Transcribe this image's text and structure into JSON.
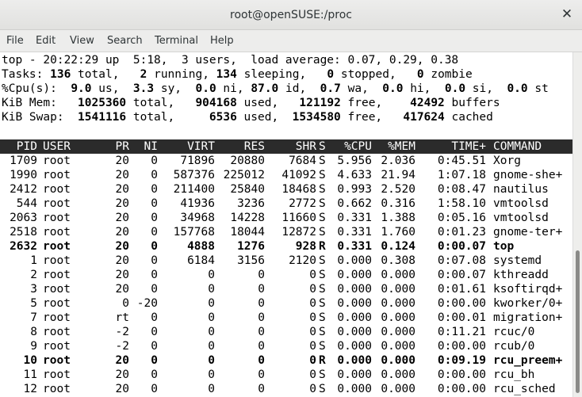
{
  "window": {
    "title": "root@openSUSE:/proc",
    "close_symbol": "✕"
  },
  "menu": [
    "File",
    "Edit",
    "View",
    "Search",
    "Terminal",
    "Help"
  ],
  "summary": [
    [
      {
        "t": "top - 20:22:29 up  5:18,  3 users,  load average: 0.07, 0.29, 0.38"
      }
    ],
    [
      {
        "t": "Tasks: "
      },
      {
        "t": "136",
        "b": true
      },
      {
        "t": " total,   "
      },
      {
        "t": "2",
        "b": true
      },
      {
        "t": " running, "
      },
      {
        "t": "134",
        "b": true
      },
      {
        "t": " sleeping,   "
      },
      {
        "t": "0",
        "b": true
      },
      {
        "t": " stopped,   "
      },
      {
        "t": "0",
        "b": true
      },
      {
        "t": " zombie"
      }
    ],
    [
      {
        "t": "%Cpu(s):  "
      },
      {
        "t": "9.0",
        "b": true
      },
      {
        "t": " us,  "
      },
      {
        "t": "3.3",
        "b": true
      },
      {
        "t": " sy,  "
      },
      {
        "t": "0.0",
        "b": true
      },
      {
        "t": " ni, "
      },
      {
        "t": "87.0",
        "b": true
      },
      {
        "t": " id,  "
      },
      {
        "t": "0.7",
        "b": true
      },
      {
        "t": " wa,  "
      },
      {
        "t": "0.0",
        "b": true
      },
      {
        "t": " hi,  "
      },
      {
        "t": "0.0",
        "b": true
      },
      {
        "t": " si,  "
      },
      {
        "t": "0.0",
        "b": true
      },
      {
        "t": " st"
      }
    ],
    [
      {
        "t": "KiB Mem:   "
      },
      {
        "t": "1025360",
        "b": true
      },
      {
        "t": " total,   "
      },
      {
        "t": "904168",
        "b": true
      },
      {
        "t": " used,   "
      },
      {
        "t": "121192",
        "b": true
      },
      {
        "t": " free,    "
      },
      {
        "t": "42492",
        "b": true
      },
      {
        "t": " buffers"
      }
    ],
    [
      {
        "t": "KiB Swap:  "
      },
      {
        "t": "1541116",
        "b": true
      },
      {
        "t": " total,     "
      },
      {
        "t": "6536",
        "b": true
      },
      {
        "t": " used,  "
      },
      {
        "t": "1534580",
        "b": true
      },
      {
        "t": " free,   "
      },
      {
        "t": "417624",
        "b": true
      },
      {
        "t": " cached"
      }
    ]
  ],
  "table": {
    "columns": [
      "PID",
      "USER",
      "PR",
      "NI",
      "VIRT",
      "RES",
      "SHR",
      "S",
      "%CPU",
      "%MEM",
      "TIME+",
      "COMMAND"
    ],
    "rows": [
      {
        "cells": [
          "1709",
          "root",
          "20",
          "0",
          "71896",
          "20880",
          "7684",
          "S",
          "5.956",
          "2.036",
          "0:45.51",
          "Xorg"
        ]
      },
      {
        "cells": [
          "1990",
          "root",
          "20",
          "0",
          "587376",
          "225012",
          "41092",
          "S",
          "4.633",
          "21.94",
          "1:07.18",
          "gnome-she+"
        ]
      },
      {
        "cells": [
          "2412",
          "root",
          "20",
          "0",
          "211400",
          "25840",
          "18468",
          "S",
          "0.993",
          "2.520",
          "0:08.47",
          "nautilus"
        ]
      },
      {
        "cells": [
          "544",
          "root",
          "20",
          "0",
          "41936",
          "3236",
          "2772",
          "S",
          "0.662",
          "0.316",
          "1:58.10",
          "vmtoolsd"
        ]
      },
      {
        "cells": [
          "2063",
          "root",
          "20",
          "0",
          "34968",
          "14228",
          "11660",
          "S",
          "0.331",
          "1.388",
          "0:05.16",
          "vmtoolsd"
        ]
      },
      {
        "cells": [
          "2518",
          "root",
          "20",
          "0",
          "157768",
          "18044",
          "12872",
          "S",
          "0.331",
          "1.760",
          "0:01.23",
          "gnome-ter+"
        ]
      },
      {
        "cells": [
          "2632",
          "root",
          "20",
          "0",
          "4888",
          "1276",
          "928",
          "R",
          "0.331",
          "0.124",
          "0:00.07",
          "top"
        ],
        "bold": true
      },
      {
        "cells": [
          "1",
          "root",
          "20",
          "0",
          "6184",
          "3156",
          "2120",
          "S",
          "0.000",
          "0.308",
          "0:07.08",
          "systemd"
        ]
      },
      {
        "cells": [
          "2",
          "root",
          "20",
          "0",
          "0",
          "0",
          "0",
          "S",
          "0.000",
          "0.000",
          "0:00.07",
          "kthreadd"
        ]
      },
      {
        "cells": [
          "3",
          "root",
          "20",
          "0",
          "0",
          "0",
          "0",
          "S",
          "0.000",
          "0.000",
          "0:01.61",
          "ksoftirqd+"
        ]
      },
      {
        "cells": [
          "5",
          "root",
          "0",
          "-20",
          "0",
          "0",
          "0",
          "S",
          "0.000",
          "0.000",
          "0:00.00",
          "kworker/0+"
        ]
      },
      {
        "cells": [
          "7",
          "root",
          "rt",
          "0",
          "0",
          "0",
          "0",
          "S",
          "0.000",
          "0.000",
          "0:00.01",
          "migration+"
        ]
      },
      {
        "cells": [
          "8",
          "root",
          "-2",
          "0",
          "0",
          "0",
          "0",
          "S",
          "0.000",
          "0.000",
          "0:11.21",
          "rcuc/0"
        ]
      },
      {
        "cells": [
          "9",
          "root",
          "-2",
          "0",
          "0",
          "0",
          "0",
          "S",
          "0.000",
          "0.000",
          "0:00.00",
          "rcub/0"
        ]
      },
      {
        "cells": [
          "10",
          "root",
          "20",
          "0",
          "0",
          "0",
          "0",
          "R",
          "0.000",
          "0.000",
          "0:09.19",
          "rcu_preem+"
        ],
        "bold": true
      },
      {
        "cells": [
          "11",
          "root",
          "20",
          "0",
          "0",
          "0",
          "0",
          "S",
          "0.000",
          "0.000",
          "0:00.00",
          "rcu_bh"
        ]
      },
      {
        "cells": [
          "12",
          "root",
          "20",
          "0",
          "0",
          "0",
          "0",
          "S",
          "0.000",
          "0.000",
          "0:00.00",
          "rcu_sched"
        ]
      }
    ]
  }
}
